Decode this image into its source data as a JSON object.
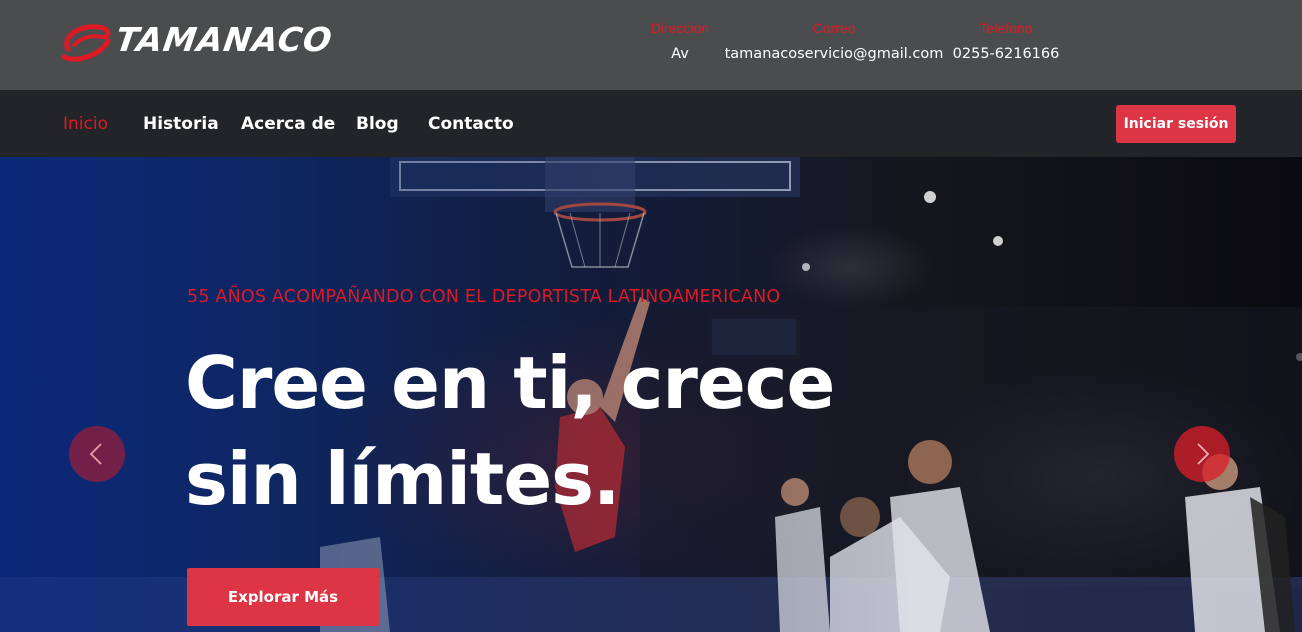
{
  "header": {
    "logo_text": "TAMANACO",
    "contact": {
      "address_label": "Direccion",
      "address_value": "Av",
      "email_label": "Correo",
      "email_value": "tamanacoservicio@gmail.com",
      "phone_label": "Telefono",
      "phone_value": "0255-6216166"
    }
  },
  "nav": {
    "items": [
      {
        "label": "Inicio",
        "active": true
      },
      {
        "label": "Historia"
      },
      {
        "label": "Acerca de"
      },
      {
        "label": "Blog"
      },
      {
        "label": "Contacto"
      }
    ],
    "login_label": "Iniciar sesión"
  },
  "hero": {
    "kicker": "55 AÑOS ACOMPAÑANDO CON EL DEPORTISTA LATINOAMERICANO",
    "title": "Cree en ti, crece sin límites.",
    "cta_label": "Explorar Más",
    "prev_icon": "chevron-left-icon",
    "next_icon": "chevron-right-icon"
  },
  "colors": {
    "accent": "#dc3545",
    "brand_red": "#dc1a24",
    "topbar": "#4a4c4e",
    "navbar": "#232427"
  }
}
